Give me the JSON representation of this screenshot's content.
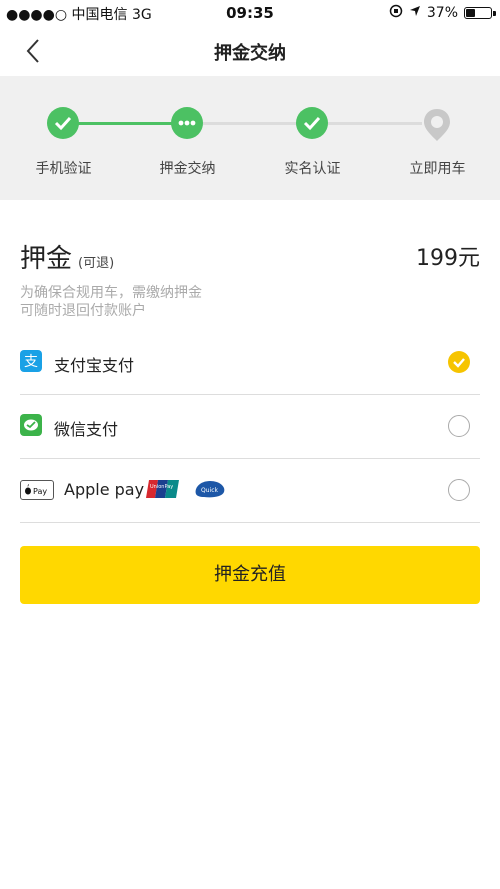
{
  "status": {
    "carrier": "●●●●○ 中国电信  3G",
    "time": "09:35",
    "battery_text": "37%"
  },
  "nav": {
    "title": "押金交纳",
    "back_icon": "chevron-left-icon"
  },
  "steps": [
    {
      "label": "手机验证",
      "state": "done"
    },
    {
      "label": "押金交纳",
      "state": "current"
    },
    {
      "label": "实名认证",
      "state": "done"
    },
    {
      "label": "立即用车",
      "state": "pending"
    }
  ],
  "deposit": {
    "title": "押金",
    "note": "(可退)",
    "amount": "199元",
    "desc_line1": "为确保合规用车，需缴纳押金",
    "desc_line2": "可随时退回付款账户"
  },
  "payment_methods": [
    {
      "label": "支付宝支付",
      "icon": "alipay-icon",
      "selected": true
    },
    {
      "label": "微信支付",
      "icon": "wechat-pay-icon",
      "selected": false
    },
    {
      "label": "Apple pay",
      "icon": "apple-pay-icon",
      "selected": false,
      "extra_logos": [
        "unionpay-logo",
        "quickpass-logo"
      ]
    }
  ],
  "button": {
    "label": "押金充值"
  },
  "colors": {
    "accent_green": "#4cc163",
    "accent_yellow": "#ffd800",
    "radio_selected": "#f6c400",
    "pending_gray": "#c8c8c8"
  }
}
